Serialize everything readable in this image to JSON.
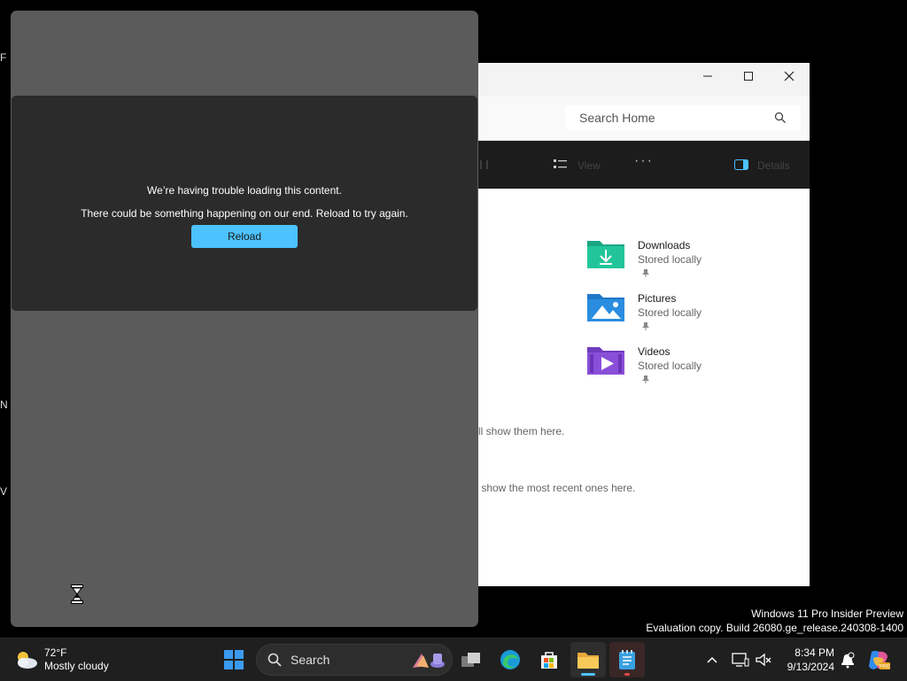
{
  "desktop": {
    "fragments": [
      "F",
      "N",
      "V"
    ]
  },
  "explorer": {
    "search_placeholder": "Search Home",
    "toolbar": {
      "view_label": "View",
      "details_label": "Details"
    },
    "quick_access": [
      {
        "name": "Downloads",
        "status": "Stored locally",
        "icon": "download-folder-icon",
        "color": "#1aa683"
      },
      {
        "name": "Pictures",
        "status": "Stored locally",
        "icon": "pictures-folder-icon",
        "color": "#2a8de0"
      },
      {
        "name": "Videos",
        "status": "Stored locally",
        "icon": "videos-folder-icon",
        "color": "#8a4fd8"
      }
    ],
    "favorites_msg": "ll show them here.",
    "recent_msg": " show the most recent ones here."
  },
  "panel": {
    "error_title": "We’re having trouble loading this content.",
    "error_subtitle": "There could be something happening on our end. Reload to try again.",
    "reload_label": "Reload"
  },
  "watermark": {
    "line1": "Windows 11 Pro Insider Preview",
    "line2": "Evaluation copy. Build 26080.ge_release.240308-1400"
  },
  "taskbar": {
    "weather": {
      "temp": "72°F",
      "condition": "Mostly cloudy"
    },
    "search_label": "Search",
    "clock": {
      "time": "8:34 PM",
      "date": "9/13/2024"
    },
    "accent": "#4cc2ff"
  }
}
